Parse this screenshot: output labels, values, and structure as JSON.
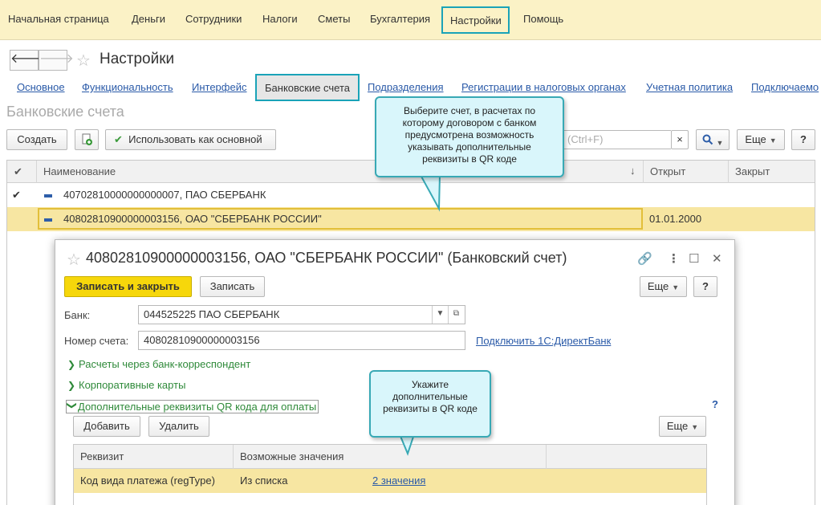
{
  "topmenu": {
    "items": [
      "Начальная страница",
      "Деньги",
      "Сотрудники",
      "Налоги",
      "Сметы",
      "Бухгалтерия",
      "Настройки",
      "Помощь"
    ]
  },
  "titlebar": {
    "back": "🡐",
    "forward": "🡒",
    "title": "Настройки"
  },
  "tabs": [
    "Основное",
    "Функциональность",
    "Интерфейс",
    "Банковские счета",
    "Подразделения",
    "Регистрации в налоговых органах",
    "Учетная политика",
    "Подключаемо"
  ],
  "section_title": "Банковские счета",
  "toolbar": {
    "create": "Создать",
    "use_main": "Использовать как основной",
    "search_placeholder": "(Ctrl+F)",
    "clear": "×",
    "more": "Еще",
    "help": "?"
  },
  "list": {
    "columns": [
      "Наименование",
      "Открыт",
      "Закрыт"
    ],
    "sort_icon": "↓",
    "rows": [
      {
        "name": "40702810000000000007, ПАО СБЕРБАНК",
        "opened": "",
        "closed": ""
      },
      {
        "name": "40802810900000003156, ОАО \"СБЕРБАНК РОССИИ\"",
        "opened": "01.01.2000",
        "closed": ""
      }
    ]
  },
  "callout1": "Выберите счет, в расчетах по которому договором с банком предусмотрена возможность указывать дополнительные реквизиты в QR коде",
  "callout2": "Укажите дополнительные реквизиты в QR коде",
  "dialog": {
    "title": "40802810900000003156, ОАО \"СБЕРБАНК РОССИИ\" (Банковский счет)",
    "save_close": "Записать и закрыть",
    "save": "Записать",
    "more": "Еще",
    "help": "?",
    "bank_label": "Банк:",
    "bank_value": "044525225 ПАО СБЕРБАНК",
    "account_label": "Номер счета:",
    "account_value": "40802810900000003156",
    "directbank_link": "Подключить 1С:ДиректБанк",
    "group1": "Расчеты через банк-корреспондент",
    "group2": "Корпоративные карты",
    "group3": "Дополнительные реквизиты QR кода для оплаты",
    "group_help": "?",
    "add": "Добавить",
    "delete": "Удалить",
    "more2": "Еще",
    "grid_columns": [
      "Реквизит",
      "Возможные значения"
    ],
    "grid_rows": [
      {
        "req": "Код вида платежа (regType)",
        "kind": "Из списка",
        "values": "2 значения"
      }
    ]
  }
}
